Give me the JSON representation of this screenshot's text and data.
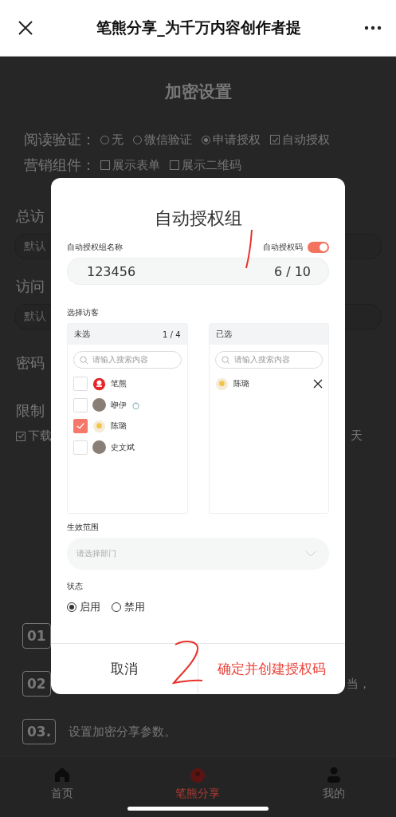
{
  "nav": {
    "title": "笔熊分享_为千万内容创作者提"
  },
  "page": {
    "title": "加密设置",
    "read_verify": {
      "label": "阅读验证：",
      "options": [
        {
          "label": "无",
          "kind": "radio",
          "selected": false
        },
        {
          "label": "微信验证",
          "kind": "radio",
          "selected": false
        },
        {
          "label": "申请授权",
          "kind": "radio",
          "selected": true
        },
        {
          "label": "自动授权",
          "kind": "checkbox",
          "checked": true
        }
      ]
    },
    "marketing": {
      "label": "营销组件：",
      "options": [
        {
          "label": "展示表单",
          "checked": false
        },
        {
          "label": "展示二维码",
          "checked": false
        }
      ]
    },
    "fields": [
      {
        "label": "总访",
        "placeholder": "默认"
      },
      {
        "label": "访问",
        "placeholder": "默认"
      }
    ],
    "password_label": "密码",
    "limit_label": "限制",
    "download": {
      "label": "下载",
      "checked": true,
      "days": "天"
    },
    "steps": [
      {
        "number": "01"
      },
      {
        "number": "02",
        "text": "当，"
      },
      {
        "number": "03.",
        "text": "设置加密分享参数。"
      }
    ]
  },
  "tabbar": [
    {
      "label": "首页",
      "selected": false
    },
    {
      "label": "笔熊分享",
      "selected": true
    },
    {
      "label": "我的",
      "selected": false
    }
  ],
  "dialog": {
    "title": "自动授权组",
    "name_label": "自动授权组名称",
    "code_toggle": {
      "label": "自动授权码",
      "on": true
    },
    "name_input": {
      "value": "123456",
      "count": "6 / 10"
    },
    "visitors_label": "选择访客",
    "unselected": {
      "title": "未选",
      "count": "1 / 4",
      "placeholder": "请输入搜索内容",
      "items": [
        {
          "name": "笔熊",
          "kind": "logo",
          "checked": false
        },
        {
          "name": "咿伊",
          "kind": "photo",
          "ring": true,
          "checked": false
        },
        {
          "name": "陈璐",
          "kind": "flower",
          "checked": true
        },
        {
          "name": "史文斌",
          "kind": "photo",
          "checked": false
        }
      ]
    },
    "selected": {
      "title": "已选",
      "placeholder": "请输入搜索内容",
      "items": [
        {
          "name": "陈璐",
          "kind": "flower"
        }
      ]
    },
    "scope": {
      "label": "生效范围",
      "placeholder": "请选择部门"
    },
    "status": {
      "label": "状态",
      "options": [
        {
          "label": "启用",
          "selected": true
        },
        {
          "label": "禁用",
          "selected": false
        }
      ]
    },
    "buttons": [
      {
        "label": "取消",
        "kind": "cancel"
      },
      {
        "label": "确定并创建授权码",
        "kind": "confirm"
      }
    ]
  }
}
